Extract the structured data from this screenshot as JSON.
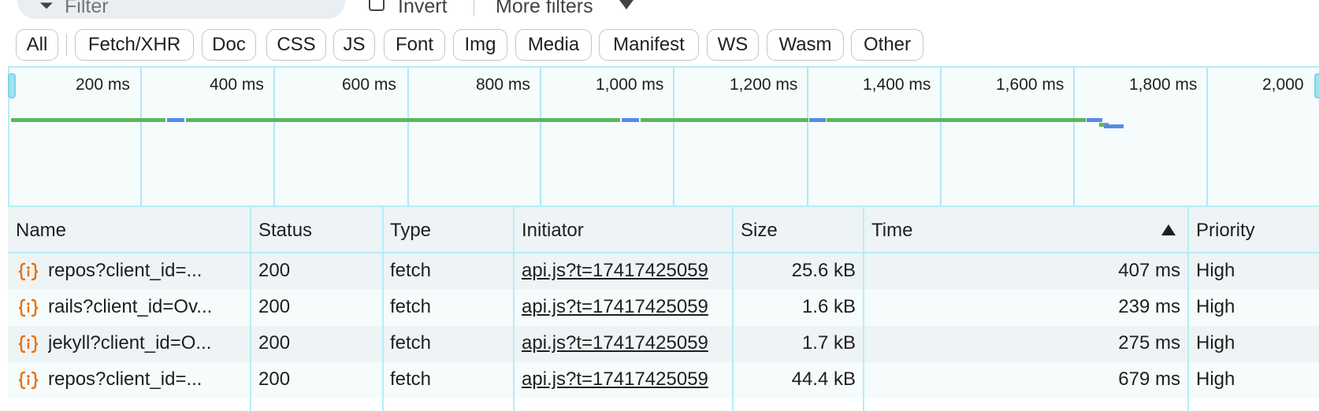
{
  "toolbar": {
    "filter_placeholder": "Filter",
    "invert_label": "Invert",
    "more_filters_label": "More filters"
  },
  "type_filters": [
    {
      "label": "All",
      "active": false
    },
    {
      "label": "Fetch/XHR",
      "active": true
    },
    {
      "label": "Doc",
      "active": false
    },
    {
      "label": "CSS",
      "active": false
    },
    {
      "label": "JS",
      "active": false
    },
    {
      "label": "Font",
      "active": false
    },
    {
      "label": "Img",
      "active": false
    },
    {
      "label": "Media",
      "active": false
    },
    {
      "label": "Manifest",
      "active": false
    },
    {
      "label": "WS",
      "active": false
    },
    {
      "label": "Wasm",
      "active": false
    },
    {
      "label": "Other",
      "active": false
    }
  ],
  "overview": {
    "ticks": [
      "200 ms",
      "400 ms",
      "600 ms",
      "800 ms",
      "1,000 ms",
      "1,200 ms",
      "1,400 ms",
      "1,600 ms",
      "1,800 ms",
      "2,000"
    ],
    "colors": {
      "waiting": "#5cb85c",
      "download": "#5a8ae6"
    }
  },
  "table": {
    "columns": {
      "name": "Name",
      "status": "Status",
      "type": "Type",
      "initiator": "Initiator",
      "size": "Size",
      "time": "Time",
      "priority": "Priority"
    },
    "sorted_column": "Time",
    "sort_direction": "ascending",
    "rows": [
      {
        "name": "repos?client_id=...",
        "status": "200",
        "type": "fetch",
        "initiator": "api.js?t=17417425059",
        "size": "25.6 kB",
        "time": "407 ms",
        "priority": "High"
      },
      {
        "name": "rails?client_id=Ov...",
        "status": "200",
        "type": "fetch",
        "initiator": "api.js?t=17417425059",
        "size": "1.6 kB",
        "time": "239 ms",
        "priority": "High"
      },
      {
        "name": "jekyll?client_id=O...",
        "status": "200",
        "type": "fetch",
        "initiator": "api.js?t=17417425059",
        "size": "1.7 kB",
        "time": "275 ms",
        "priority": "High"
      },
      {
        "name": "repos?client_id=...",
        "status": "200",
        "type": "fetch",
        "initiator": "api.js?t=17417425059",
        "size": "44.4 kB",
        "time": "679 ms",
        "priority": "High"
      }
    ]
  },
  "icons": {
    "filter": "funnel-icon",
    "request": "fetch-braces-icon",
    "sort": "sort-ascending-icon",
    "dropdown": "chevron-down-icon"
  },
  "colors": {
    "accent_chip": "#ade8f7",
    "grid_line": "#aeeaf3",
    "fetch_icon": "#e8710a"
  }
}
